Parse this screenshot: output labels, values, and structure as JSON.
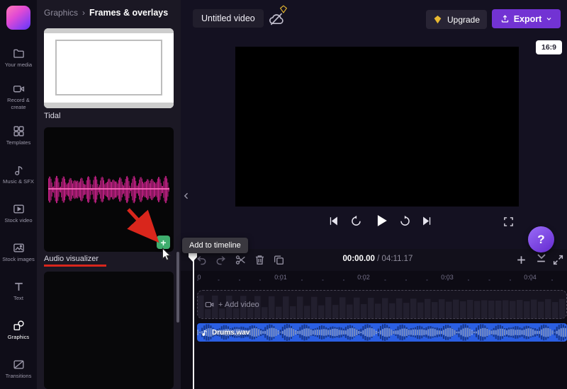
{
  "sidebar": {
    "items": [
      {
        "label": "Your media",
        "icon": "folder-icon",
        "selected": false
      },
      {
        "label": "Record & create",
        "icon": "camera-icon",
        "selected": false
      },
      {
        "label": "Templates",
        "icon": "templates-grid-icon",
        "selected": false
      },
      {
        "label": "Music & SFX",
        "icon": "music-note-icon",
        "selected": false
      },
      {
        "label": "Stock video",
        "icon": "stock-video-icon",
        "selected": false
      },
      {
        "label": "Stock images",
        "icon": "stock-image-icon",
        "selected": false
      },
      {
        "label": "Text",
        "icon": "text-icon",
        "selected": false
      },
      {
        "label": "Graphics",
        "icon": "shapes-icon",
        "selected": true
      },
      {
        "label": "Transitions",
        "icon": "transitions-icon",
        "selected": false
      }
    ]
  },
  "panel": {
    "breadcrumb": {
      "parent": "Graphics",
      "separator": "›",
      "current": "Frames & overlays"
    },
    "cards": [
      {
        "label": "Tidal"
      },
      {
        "label": "Audio visualizer"
      }
    ],
    "add_button_label": "+",
    "tooltip": "Add to timeline"
  },
  "topbar": {
    "title": "Untitled video",
    "upgrade_label": "Upgrade",
    "export_label": "Export"
  },
  "preview": {
    "aspect_badge": "16:9"
  },
  "timeline": {
    "current_time": "00:00.00",
    "time_separator": "/",
    "total_time": "04:11.17",
    "ruler_ticks": [
      "0",
      "0:01",
      "0:02",
      "0:03",
      "0:04"
    ],
    "video_track_placeholder": "+ Add video",
    "audio_clip_name": "Drums.wav"
  },
  "help_button": {
    "label": "?"
  },
  "colors": {
    "accent_purple": "#7233d3",
    "clip_blue": "#2b5fe3",
    "plus_green": "#3fae6e",
    "annotation_red": "#d9261c",
    "premium_yellow": "#e8b931",
    "visualizer_pink": "#e3259b"
  }
}
